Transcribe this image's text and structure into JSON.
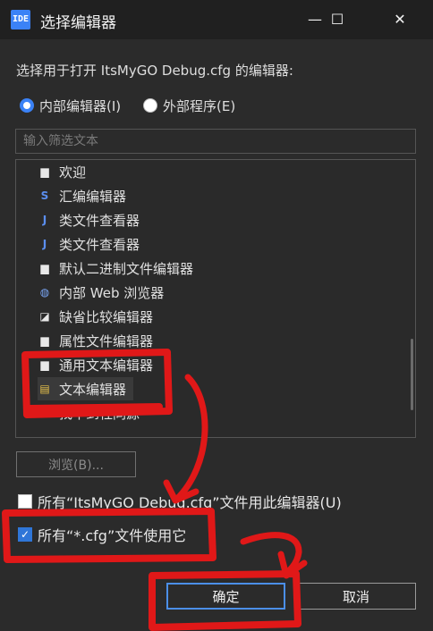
{
  "window": {
    "app_icon_text": "IDE",
    "title": "选择编辑器",
    "minimize": "—",
    "maximize": "☐",
    "close": "✕"
  },
  "prompt": "选择用于打开 ItsMyGO Debug.cfg 的编辑器:",
  "radios": {
    "internal": "内部编辑器(I)",
    "external": "外部程序(E)"
  },
  "filter_placeholder": "输入筛选文本",
  "editors": [
    {
      "label": "欢迎",
      "icon": "doc-icon",
      "glyph": "▆"
    },
    {
      "label": "汇编编辑器",
      "icon": "s-icon",
      "glyph": "S"
    },
    {
      "label": "类文件查看器",
      "icon": "j-icon",
      "glyph": "J"
    },
    {
      "label": "类文件查看器",
      "icon": "j-icon",
      "glyph": "J"
    },
    {
      "label": "默认二进制文件编辑器",
      "icon": "binary-doc-icon",
      "glyph": "▆"
    },
    {
      "label": "内部 Web 浏览器",
      "icon": "globe-icon",
      "glyph": "◍"
    },
    {
      "label": "缺省比较编辑器",
      "icon": "compare-icon",
      "glyph": "◪"
    },
    {
      "label": "属性文件编辑器",
      "icon": "doc-icon",
      "glyph": "▆"
    },
    {
      "label": "通用文本编辑器",
      "icon": "doc-icon",
      "glyph": "▆"
    },
    {
      "label": "文本编辑器",
      "icon": "text-doc-icon",
      "glyph": "▤"
    },
    {
      "label": "找不到社同源",
      "icon": "bar-icon",
      "glyph": "▬"
    }
  ],
  "browse_label": "浏览(B)...",
  "checkbox_file": "所有“ItsMyGO Debug.cfg”文件用此编辑器(U)",
  "checkbox_ext": "所有“*.cfg”文件使用它",
  "ok_label": "确定",
  "cancel_label": "取消",
  "colors": {
    "accent": "#3b82f6",
    "annotation": "#e01818"
  }
}
